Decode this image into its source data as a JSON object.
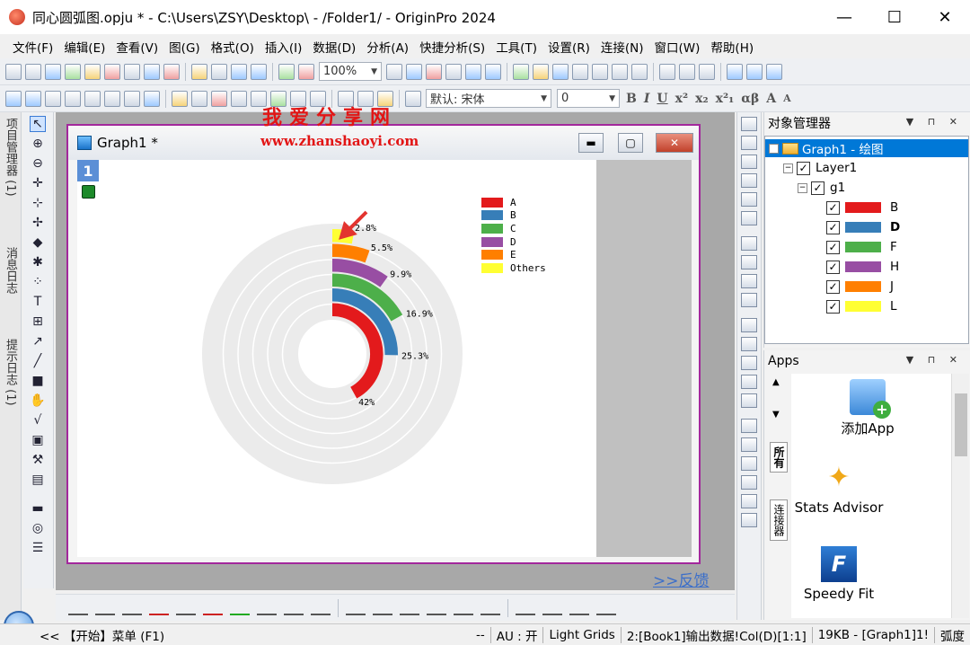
{
  "window": {
    "title": "同心圆弧图.opju * - C:\\Users\\ZSY\\Desktop\\ - /Folder1/ - OriginPro 2024",
    "minimize": "—",
    "maximize": "☐",
    "close": "✕"
  },
  "menu": [
    "文件(F)",
    "编辑(E)",
    "查看(V)",
    "图(G)",
    "格式(O)",
    "插入(I)",
    "数据(D)",
    "分析(A)",
    "快捷分析(S)",
    "工具(T)",
    "设置(R)",
    "连接(N)",
    "窗口(W)",
    "帮助(H)"
  ],
  "toolbar": {
    "zoom": "100%",
    "font_name": "默认: 宋体",
    "font_size": "0",
    "format_buttons": [
      "B",
      "I",
      "U",
      "x²",
      "x₂",
      "x²₁",
      "αβ",
      "A",
      "A"
    ]
  },
  "left_tabs": [
    "项目管理器 (1)",
    "消息日志",
    "提示日志 (1)"
  ],
  "watermark": {
    "text": "我爱分享网",
    "url": "www.zhanshaoyi.com"
  },
  "graph_window": {
    "title": "Graph1 *",
    "layer_number": "1"
  },
  "chart_data": {
    "type": "pie",
    "variant": "concentric-arc",
    "legend_position": "top-right",
    "background_ring_color": "#ebebeb",
    "series": [
      {
        "name": "A",
        "value": 42,
        "label": "42%",
        "color": "#e31a1c"
      },
      {
        "name": "B",
        "value": 25.3,
        "label": "25.3%",
        "color": "#377eb8"
      },
      {
        "name": "C",
        "value": 16.9,
        "label": "16.9%",
        "color": "#4daf4a"
      },
      {
        "name": "D",
        "value": 9.9,
        "label": "9.9%",
        "color": "#984ea3"
      },
      {
        "name": "E",
        "value": 5.5,
        "label": "5.5%",
        "color": "#ff7f00"
      },
      {
        "name": "Others",
        "value": 2.8,
        "label": "2.8%",
        "color": "#ffff33"
      }
    ]
  },
  "object_manager": {
    "title": "对象管理器",
    "root": "Graph1 - 绘图",
    "layer": "Layer1",
    "group": "g1",
    "plots": [
      {
        "label": "B",
        "color": "#e31a1c",
        "bold": false
      },
      {
        "label": "D",
        "color": "#377eb8",
        "bold": true
      },
      {
        "label": "F",
        "color": "#4daf4a",
        "bold": false
      },
      {
        "label": "H",
        "color": "#984ea3",
        "bold": false
      },
      {
        "label": "J",
        "color": "#ff7f00",
        "bold": false
      },
      {
        "label": "L",
        "color": "#ffff33",
        "bold": false
      }
    ]
  },
  "apps": {
    "title": "Apps",
    "tabs": [
      "所有",
      "连接器"
    ],
    "items": [
      "添加App",
      "Stats Advisor",
      "Speedy Fit"
    ]
  },
  "feedback": ">>反馈",
  "status": {
    "start": "<< 【开始】菜单 (F1)",
    "dash": "--",
    "au": "AU : 开",
    "grids": "Light Grids",
    "data": "2:[Book1]输出数据!Col(D)[1:1]",
    "size": "19KB - [Graph1]1!",
    "unit": "弧度"
  }
}
